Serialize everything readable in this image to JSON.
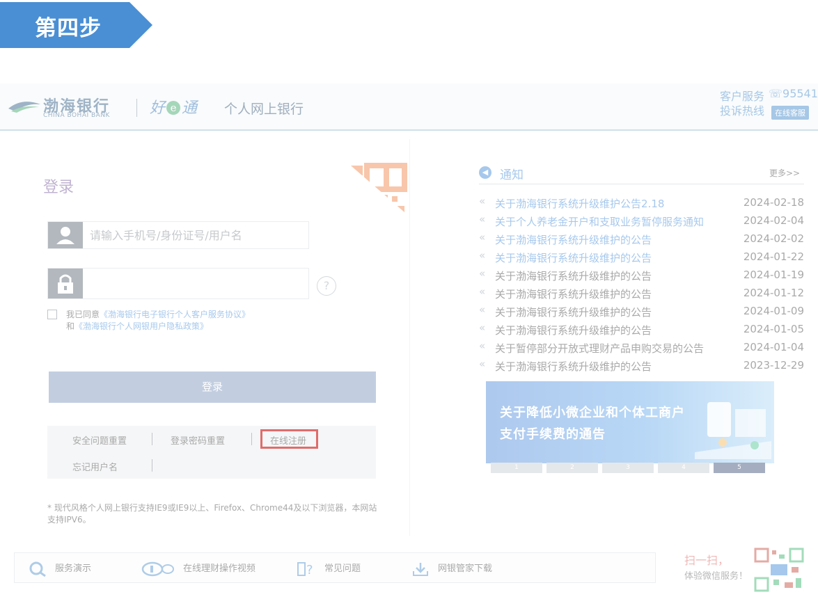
{
  "step": {
    "label": "第四步",
    "color": "#4a8fd4"
  },
  "header": {
    "bank_name_cn": "渤海银行",
    "bank_name_en": "CHINA BOHAI BANK",
    "brand_a": "好",
    "brand_e": "e",
    "brand_b": "通",
    "subtitle": "个人网上银行",
    "hotline_line1": "客户服务",
    "hotline_line2": "投诉热线",
    "hotline_number": "95541",
    "online_service": "在线客服"
  },
  "login": {
    "title": "登录",
    "username_placeholder": "请输入手机号/身份证号/用户名",
    "password_placeholder": "",
    "agree_prefix": "我已同意",
    "agree_link1": "《渤海银行电子银行个人客户服务协议》",
    "agree_and": "和",
    "agree_link2": "《渤海银行个人网银用户隐私政策》",
    "submit_label": "登录",
    "links": {
      "security_reset": "安全问题重置",
      "password_reset": "登录密码重置",
      "register": "在线注册",
      "forgot_username": "忘记用户名"
    },
    "browser_note": "* 现代风格个人网上银行支持IE9或IE9以上、Firefox、Chrome44及以下浏览器，本网站支持IPV6。"
  },
  "notices": {
    "heading": "通知",
    "more": "更多>>",
    "items": [
      {
        "title": "关于渤海银行系统升级维护公告2.18",
        "date": "2024-02-18"
      },
      {
        "title": "关于个人养老金开户和支取业务暂停服务通知",
        "date": "2024-02-04"
      },
      {
        "title": "关于渤海银行系统升级维护的公告",
        "date": "2024-02-02"
      },
      {
        "title": "关于渤海银行系统升级维护的公告",
        "date": "2024-01-22"
      },
      {
        "title": "关于渤海银行系统升级维护的公告",
        "date": "2024-01-19"
      },
      {
        "title": "关于渤海银行系统升级维护的公告",
        "date": "2024-01-12"
      },
      {
        "title": "关于渤海银行系统升级维护的公告",
        "date": "2024-01-09"
      },
      {
        "title": "关于渤海银行系统升级维护的公告",
        "date": "2024-01-05"
      },
      {
        "title": "关于暂停部分开放式理财产品申购交易的公告",
        "date": "2024-01-04"
      },
      {
        "title": "关于渤海银行系统升级维护的公告",
        "date": "2023-12-29"
      }
    ]
  },
  "promo": {
    "line1": "关于降低小微企业和个体工商户",
    "line2": "支付手续费的通告",
    "pages": [
      "1",
      "2",
      "3",
      "4",
      "5"
    ],
    "active_page": "5"
  },
  "toolbar": {
    "demo": "服务演示",
    "video": "在线理财操作视频",
    "faq": "常见问题",
    "download": "网银管家下载"
  },
  "wechat": {
    "title": "扫一扫，",
    "subtitle": "体验微信服务！"
  }
}
